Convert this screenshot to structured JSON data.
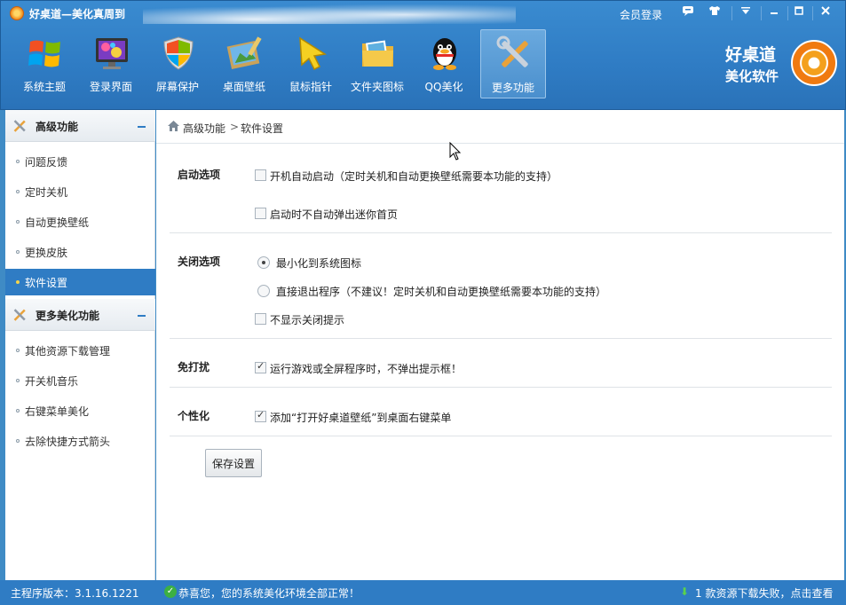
{
  "app": {
    "title": "好桌道—美化真周到"
  },
  "titlebar": {
    "member_login": "会员登录",
    "message_icon": "message-icon",
    "skin_icon": "tshirt-icon",
    "menu_icon": "dropdown-menu-icon",
    "minimize_icon": "minimize-icon",
    "maximize_icon": "maximize-icon",
    "close_icon": "close-icon"
  },
  "toolbar": {
    "items": [
      {
        "label": "系统主题",
        "icon": "windows-logo-icon"
      },
      {
        "label": "登录界面",
        "icon": "monitor-icon"
      },
      {
        "label": "屏幕保护",
        "icon": "shield-icon"
      },
      {
        "label": "桌面壁纸",
        "icon": "wallpaper-icon"
      },
      {
        "label": "鼠标指针",
        "icon": "cursor-icon"
      },
      {
        "label": "文件夹图标",
        "icon": "folder-icon"
      },
      {
        "label": "QQ美化",
        "icon": "qq-penguin-icon"
      },
      {
        "label": "更多功能",
        "icon": "tools-icon",
        "active": true
      }
    ]
  },
  "brand": {
    "line1": "好桌道",
    "line2": "美化软件"
  },
  "sidebar": {
    "sections": [
      {
        "title": "高级功能",
        "items": [
          "问题反馈",
          "定时关机",
          "自动更换壁纸",
          "更换皮肤",
          "软件设置"
        ],
        "active_item": "软件设置"
      },
      {
        "title": "更多美化功能",
        "items": [
          "其他资源下载管理",
          "开关机音乐",
          "右键菜单美化",
          "去除快捷方式箭头"
        ]
      }
    ]
  },
  "breadcrumb": {
    "root": "高级功能",
    "separator": ">",
    "current": "软件设置"
  },
  "settings": {
    "startup": {
      "label": "启动选项",
      "options": [
        {
          "text": "开机自动启动（定时关机和自动更换壁纸需要本功能的支持）",
          "checked": false
        },
        {
          "text": "启动时不自动弹出迷你首页",
          "checked": false
        }
      ]
    },
    "close": {
      "label": "关闭选项",
      "radios": [
        {
          "text": "最小化到系统图标",
          "checked": true
        },
        {
          "text": "直接退出程序（不建议！定时关机和自动更换壁纸需要本功能的支持）",
          "checked": false
        }
      ],
      "checkbox": {
        "text": "不显示关闭提示",
        "checked": false
      }
    },
    "no_disturb": {
      "label": "免打扰",
      "option": {
        "text": "运行游戏或全屏程序时，不弹出提示框！",
        "checked": true
      }
    },
    "personalize": {
      "label": "个性化",
      "option": {
        "text": "添加“打开好桌道壁纸”到桌面右键菜单",
        "checked": true
      }
    },
    "save_label": "保存设置"
  },
  "statusbar": {
    "version": "主程序版本：3.1.16.1221",
    "status": "恭喜您，您的系统美化环境全部正常！",
    "download": "1 款资源下载失败，点击查看"
  },
  "colors": {
    "header": "#2f7cc4",
    "accent": "#2f7cc4",
    "status_ok": "#3cb043"
  }
}
